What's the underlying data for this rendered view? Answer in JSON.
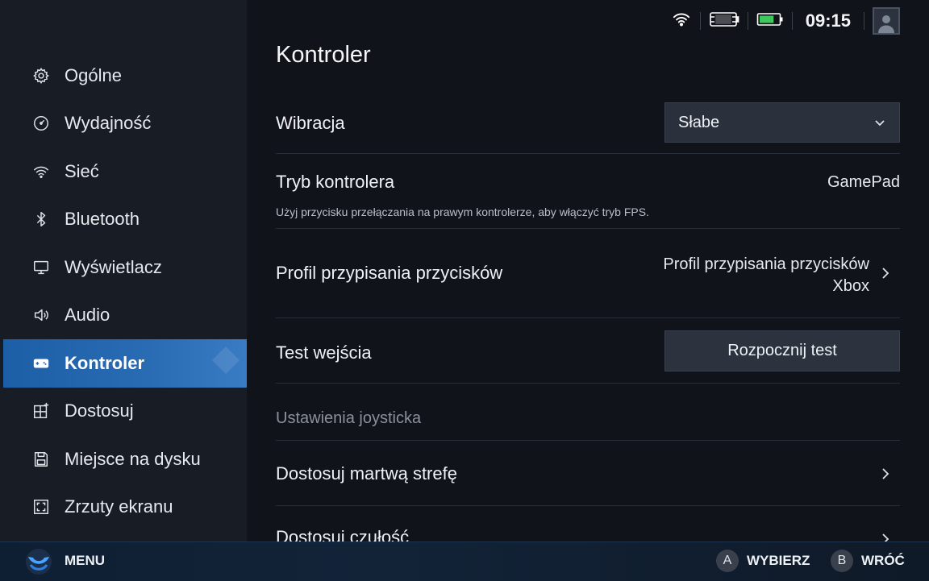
{
  "status_bar": {
    "time": "09:15",
    "icons": [
      "wifi-icon",
      "controller-icon",
      "battery-icon",
      "avatar"
    ],
    "battery_level": 0.75
  },
  "sidebar": {
    "items": [
      {
        "label": "Ogólne",
        "icon": "gear-icon",
        "active": false
      },
      {
        "label": "Wydajność",
        "icon": "gauge-icon",
        "active": false
      },
      {
        "label": "Sieć",
        "icon": "wifi-icon",
        "active": false
      },
      {
        "label": "Bluetooth",
        "icon": "bluetooth-icon",
        "active": false
      },
      {
        "label": "Wyświetlacz",
        "icon": "monitor-icon",
        "active": false
      },
      {
        "label": "Audio",
        "icon": "speaker-icon",
        "active": false
      },
      {
        "label": "Kontroler",
        "icon": "gamepad-icon",
        "active": true
      },
      {
        "label": "Dostosuj",
        "icon": "customize-grid-icon",
        "active": false
      },
      {
        "label": "Miejsce na dysku",
        "icon": "disk-icon",
        "active": false
      },
      {
        "label": "Zrzuty ekranu",
        "icon": "screenshot-icon",
        "active": false
      }
    ]
  },
  "main": {
    "title": "Kontroler",
    "vibration": {
      "label": "Wibracja",
      "value": "Słabe"
    },
    "controller_mode": {
      "label": "Tryb kontrolera",
      "value": "GamePad",
      "description": "Użyj przycisku przełączania na prawym kontrolerze, aby włączyć tryb FPS."
    },
    "button_profile": {
      "label": "Profil przypisania przycisków",
      "value_line1": "Profil przypisania przycisków",
      "value_line2": "Xbox"
    },
    "input_test": {
      "label": "Test wejścia",
      "button": "Rozpocznij test"
    },
    "joystick_section": "Ustawienia joysticka",
    "deadzone": {
      "label": "Dostosuj martwą strefę"
    },
    "sensitivity": {
      "label": "Dostosuj czułość"
    }
  },
  "footer": {
    "menu": "MENU",
    "select_key": "A",
    "select_label": "WYBIERZ",
    "back_key": "B",
    "back_label": "WRÓĆ"
  },
  "colors": {
    "accent": "#2a6cb4",
    "background": "#10131a",
    "sidebar": "#181c24",
    "battery": "#3cc85a"
  }
}
